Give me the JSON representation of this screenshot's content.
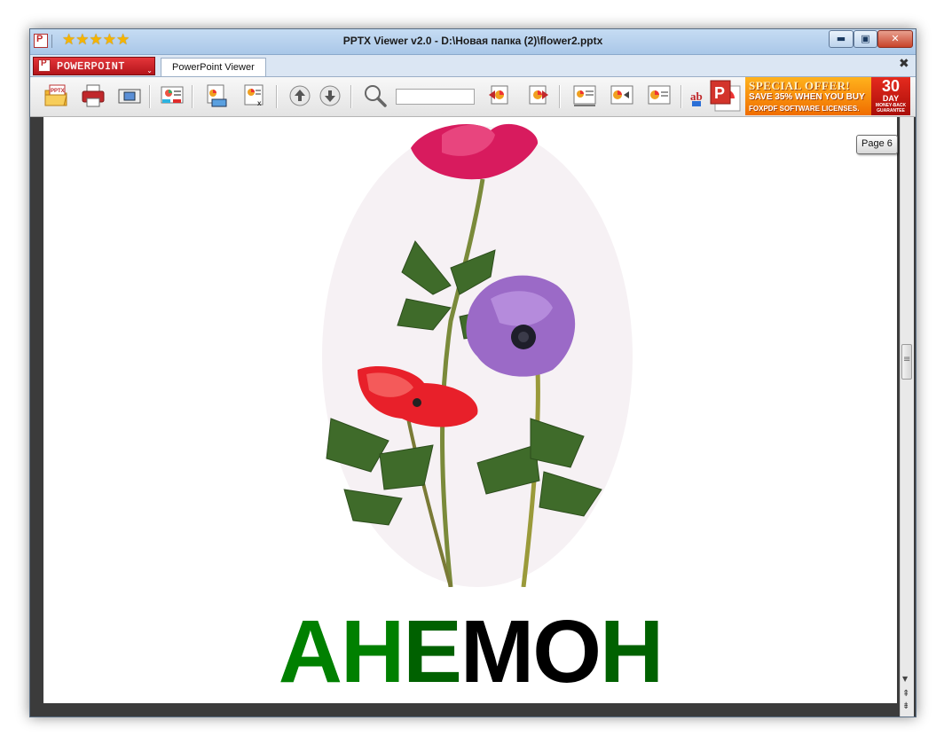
{
  "window": {
    "title": "PPTX Viewer v2.0 - D:\\Новая папка (2)\\flower2.pptx",
    "rating_stars": "★★★★★",
    "minimize_glyph": "▬",
    "maximize_glyph": "▣",
    "close_glyph": "✕"
  },
  "tabs": {
    "app_menu_label": "POWERPOINT",
    "app_menu_arrow": "⌄",
    "active_tab_label": "PowerPoint Viewer",
    "close_glyph": "✖"
  },
  "toolbar": {
    "icons": [
      "open-pptx-icon",
      "print-icon",
      "fullscreen-icon",
      "slide-show-icon",
      "slide-copy-icon",
      "slide-excel-icon",
      "page-up-icon",
      "page-down-icon",
      "search-icon",
      "first-slide-icon",
      "last-slide-icon",
      "slide-layout-icon",
      "previous-slide-icon",
      "next-slide-icon",
      "text-icon",
      "powerpoint-logo-icon"
    ],
    "open_badge": "PPTX",
    "search_value": "",
    "search_placeholder": "",
    "text_tool_label": "ab",
    "ad": {
      "line1": "SPECIAL OFFER!",
      "line2": "SAVE 35% WHEN YOU BUY",
      "line3": "FOXPDF SOFTWARE LICENSES.",
      "badge_number": "30",
      "badge_unit": "DAY",
      "badge_text": "MONEY-BACK GUARANTEE"
    }
  },
  "viewer": {
    "page_label": "Page 6",
    "slide_title_parts": [
      {
        "text": "АН",
        "color": "#008000"
      },
      {
        "text": "Е",
        "color": "#006100"
      },
      {
        "text": "МО",
        "color": "#000000"
      },
      {
        "text": "Н",
        "color": "#006100"
      }
    ],
    "scroll_up_glyph": "▲",
    "scroll_down_glyph": "▼",
    "page_prev_glyph": "⇞",
    "page_next_glyph": "⇟"
  },
  "colors": {
    "accent_red": "#c0282b",
    "flower_pink": "#d81b5e",
    "flower_purple": "#9b6ac7",
    "flower_red": "#e8202a",
    "leaf_green": "#3f6b2a"
  }
}
